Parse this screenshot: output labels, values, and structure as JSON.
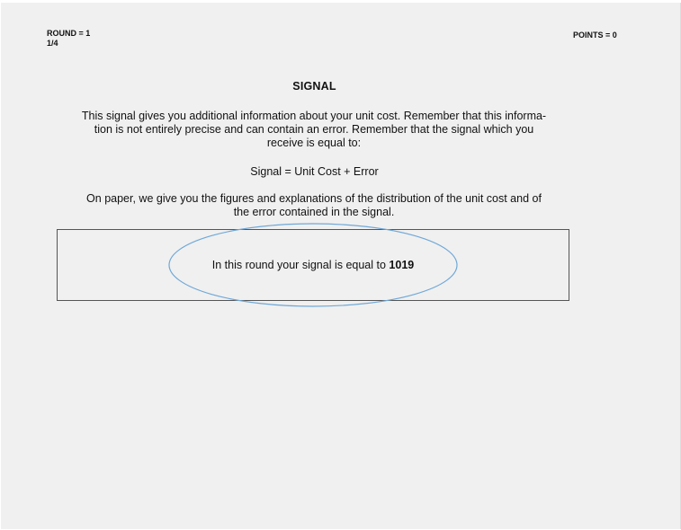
{
  "header": {
    "round_label": "ROUND = 1",
    "round_progress": "1/4",
    "points_label": "POINTS = 0"
  },
  "main": {
    "title": "SIGNAL",
    "intro_line1": "This signal gives you additional information about your unit cost. Remember that this informa-",
    "intro_line2": "tion is not entirely precise and can contain an error. Remember that the signal which you",
    "intro_line3": "receive is equal to:",
    "formula": "Signal = Unit Cost + Error",
    "paper_line1": "On paper, we give you the figures and explanations of the distribution of the unit cost and of",
    "paper_line2": "the error contained in the signal."
  },
  "signal_box": {
    "text": "In this round your signal is equal to",
    "value": "1019"
  },
  "colors": {
    "background": "#f0f0f0",
    "ellipse_stroke": "#6fa8d8",
    "box_border": "#555555"
  }
}
